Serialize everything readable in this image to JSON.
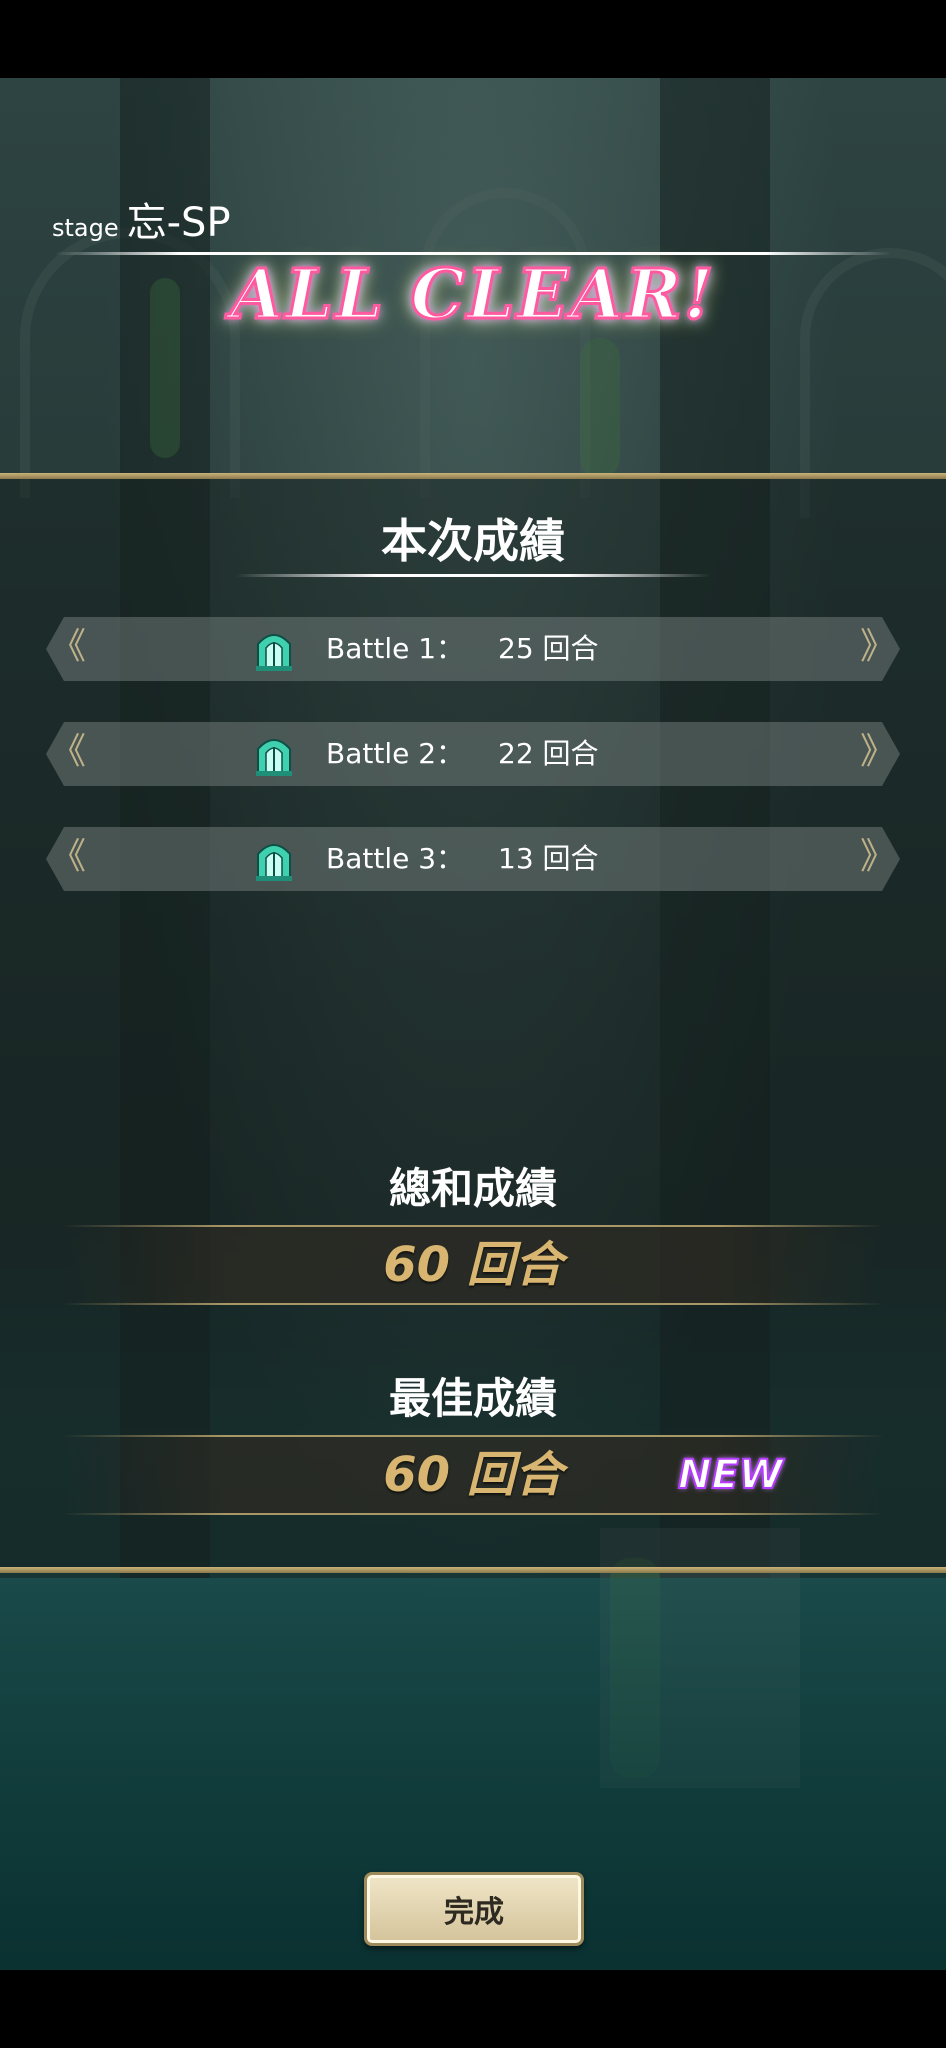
{
  "header": {
    "stage_prefix": "stage",
    "stage_name": "忘-SP",
    "banner": "ALL CLEAR!"
  },
  "results": {
    "title": "本次成績",
    "battles": [
      {
        "label": "Battle 1：",
        "turns": "25 回合",
        "icon": "gate-icon"
      },
      {
        "label": "Battle 2：",
        "turns": "22 回合",
        "icon": "gate-icon"
      },
      {
        "label": "Battle 3：",
        "turns": "13 回合",
        "icon": "gate-icon"
      }
    ]
  },
  "total": {
    "title": "總和成績",
    "value": "60 回合"
  },
  "best": {
    "title": "最佳成績",
    "value": "60 回合",
    "badge": "NEW"
  },
  "footer": {
    "done_label": "完成"
  },
  "colors": {
    "accent_gold": "#d8b570",
    "panel_border": "#c9b37a",
    "new_badge": "#b53cff",
    "gate_icon": "#3fd0b0"
  }
}
